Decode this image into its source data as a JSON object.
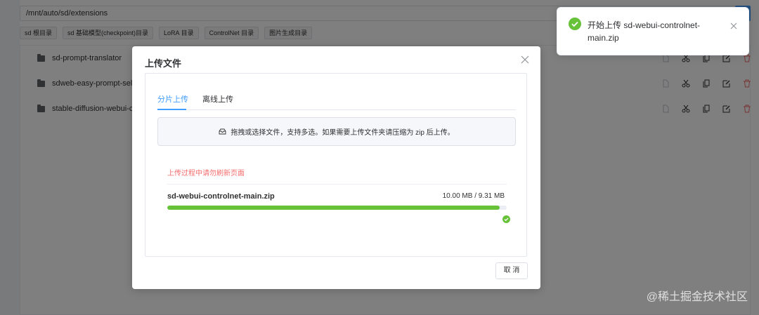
{
  "path": {
    "value": "/mnt/auto/sd/extensions"
  },
  "quick_dirs": [
    "sd 根目录",
    "sd 基础模型(checkpoint)目录",
    "LoRA 目录",
    "ControlNet 目录",
    "图片生成目录"
  ],
  "files": [
    {
      "name": "sd-prompt-translator"
    },
    {
      "name": "sdweb-easy-prompt-sele"
    },
    {
      "name": "stable-diffusion-webui-c"
    }
  ],
  "row_action_icons": [
    "file-icon",
    "cut-icon",
    "copy-icon",
    "edit-icon",
    "delete-icon"
  ],
  "dialog": {
    "title": "上传文件",
    "tabs": [
      {
        "label": "分片上传",
        "active": true
      },
      {
        "label": "离线上传",
        "active": false
      }
    ],
    "drop_hint": "拖拽或选择文件，支持多选。如果需要上传文件夹请压缩为 zip 后上传。",
    "warning": "上传过程中请勿刷新页面",
    "upload": {
      "file_name": "sd-webui-controlnet-main.zip",
      "size_text": "10.00 MB / 9.31 MB",
      "progress_percent": 98,
      "status": "success"
    },
    "cancel_label": "取 消"
  },
  "notification": {
    "message": "开始上传 sd-webui-controlnet-main.zip",
    "type": "success"
  },
  "watermark": "@稀土掘金技术社区",
  "colors": {
    "primary": "#409eff",
    "success": "#67c23a",
    "danger": "#f56c6c",
    "mask": "rgba(0,0,0,0.5)"
  }
}
